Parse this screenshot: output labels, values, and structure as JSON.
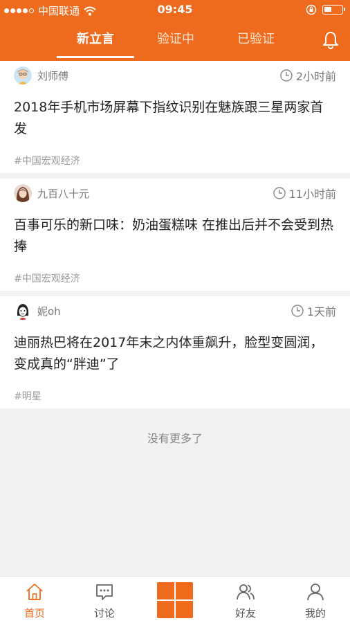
{
  "status_bar": {
    "carrier": "中国联通",
    "time": "09:45",
    "battery_percent": 45
  },
  "header": {
    "tabs": [
      {
        "label": "新立言",
        "active": true
      },
      {
        "label": "验证中",
        "active": false
      },
      {
        "label": "已验证",
        "active": false
      }
    ],
    "bell_icon": "bell-icon"
  },
  "feed": [
    {
      "author": "刘师傅",
      "time": "2小时前",
      "title": "2018年手机市场屏幕下指纹识别在魅族跟三星两家首发",
      "tag": "#中国宏观经济"
    },
    {
      "author": "九百八十元",
      "time": "11小时前",
      "title": "百事可乐的新口味：奶油蛋糕味 在推出后并不会受到热捧",
      "tag": "#中国宏观经济"
    },
    {
      "author": "妮oh",
      "time": "1天前",
      "title": "迪丽热巴将在2017年末之内体重飙升，脸型变圆润，变成真的“胖迪”了",
      "tag": "#明星"
    }
  ],
  "no_more_text": "没有更多了",
  "tabbar": {
    "items": [
      {
        "label": "首页",
        "icon": "home-icon",
        "active": true
      },
      {
        "label": "讨论",
        "icon": "chat-icon",
        "active": false
      },
      {
        "label": "好友",
        "icon": "friends-icon",
        "active": false
      },
      {
        "label": "我的",
        "icon": "profile-icon",
        "active": false
      }
    ],
    "center_icon": "grid-icon"
  },
  "colors": {
    "accent": "#ee6a1c"
  }
}
